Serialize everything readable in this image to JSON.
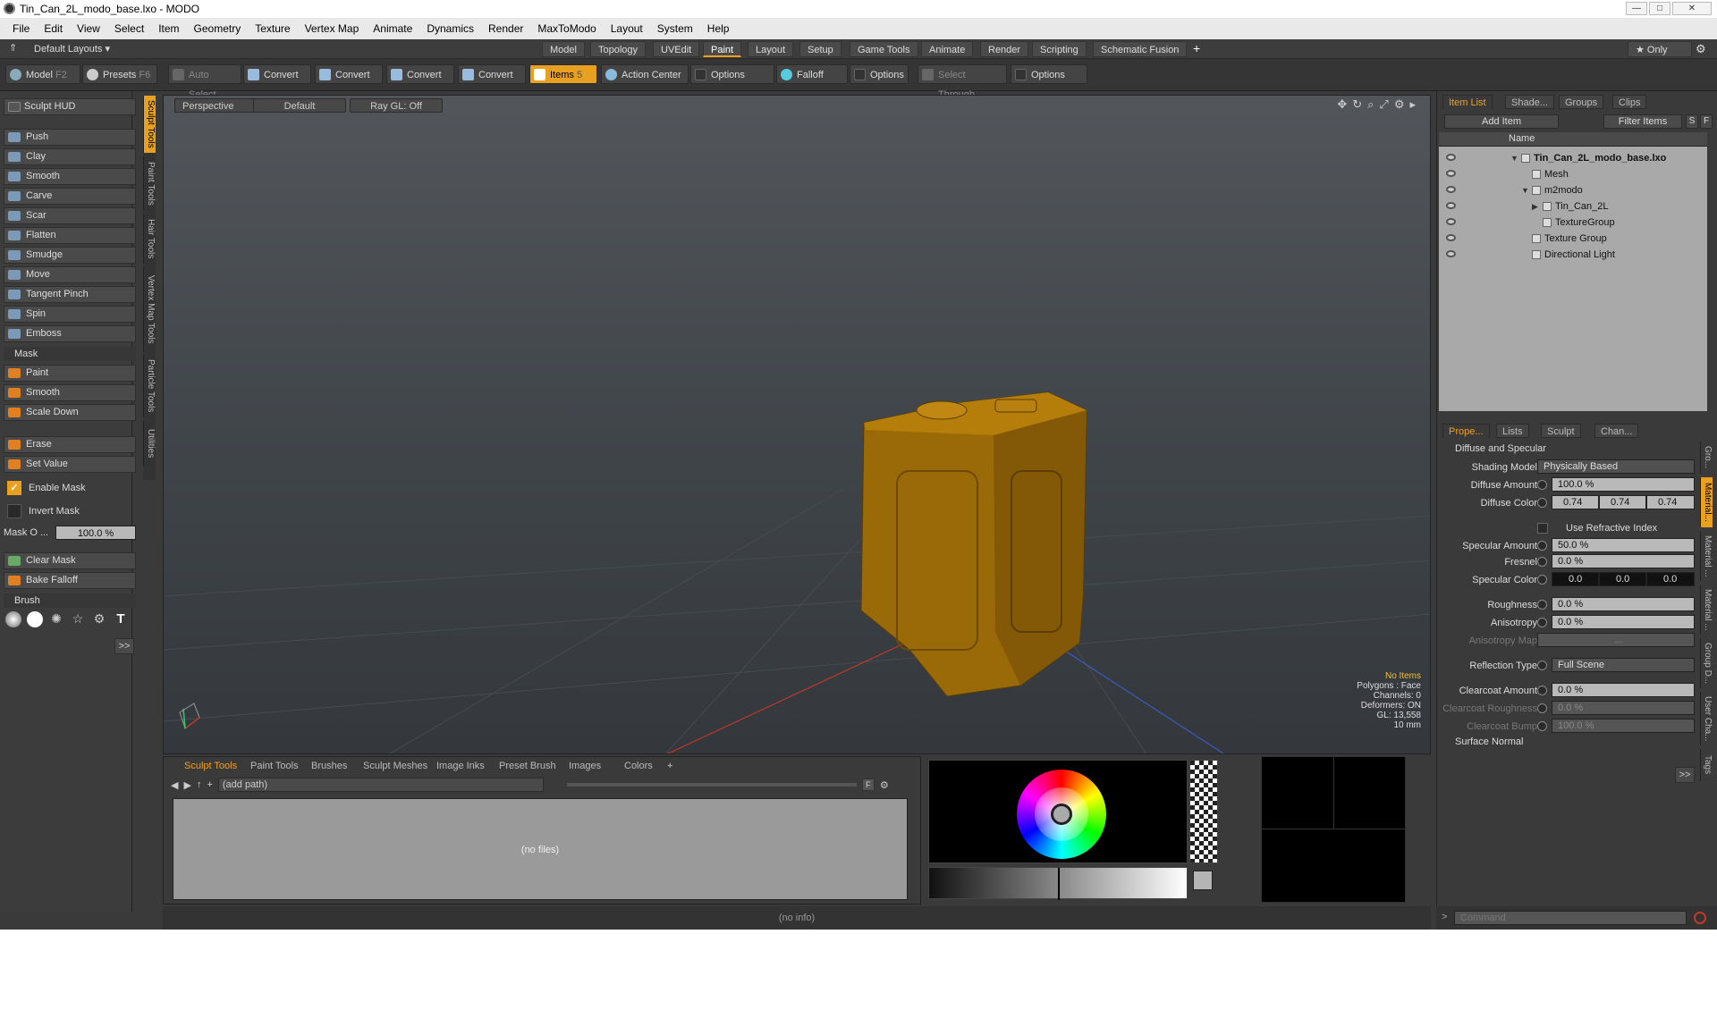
{
  "window": {
    "title": "Tin_Can_2L_modo_base.lxo - MODO",
    "min": "—",
    "max": "□",
    "close": "✕"
  },
  "menu": [
    "File",
    "Edit",
    "View",
    "Select",
    "Item",
    "Geometry",
    "Texture",
    "Vertex Map",
    "Animate",
    "Dynamics",
    "Render",
    "MaxToModo",
    "Layout",
    "System",
    "Help"
  ],
  "layout_bar": {
    "default_layouts": "Default Layouts ▾",
    "tabs": [
      "Model",
      "Topology",
      "UVEdit",
      "Paint",
      "Layout",
      "Setup",
      "Game Tools",
      "Animate",
      "Render",
      "Scripting",
      "Schematic Fusion"
    ],
    "active_tab": "Paint",
    "add": "+",
    "only": "★ Only",
    "gear": "⚙"
  },
  "toolbar": {
    "model": "Model",
    "model_key": "F2",
    "presets": "Presets",
    "presets_key": "F6",
    "auto_select": "Auto Select",
    "convert": "Convert",
    "items": "Items",
    "items_key": "5",
    "action_center": "Action Center",
    "options": "Options",
    "falloff": "Falloff",
    "select_through": "Select Through"
  },
  "left_panel": {
    "sculpt_hud": "Sculpt HUD",
    "tools": [
      "Push",
      "Clay",
      "Smooth",
      "Carve",
      "Scar",
      "Flatten",
      "Smudge",
      "Move",
      "Tangent Pinch",
      "Spin",
      "Emboss"
    ],
    "mask_header": "Mask",
    "mask_tools": [
      "Paint",
      "Smooth",
      "Scale Down"
    ],
    "erase": "Erase",
    "set_value": "Set Value",
    "enable_mask": "Enable Mask",
    "invert_mask": "Invert Mask",
    "mask_opacity_label": "Mask O ...",
    "mask_opacity_value": "100.0 %",
    "clear_mask": "Clear Mask",
    "bake_falloff": "Bake Falloff",
    "brush_header": "Brush",
    "more": ">>",
    "vertical_tabs": [
      "Sculpt Tools",
      "Paint Tools",
      "Hair Tools",
      "Vertex Map Tools",
      "Particle Tools",
      "Utilities"
    ]
  },
  "viewport": {
    "view": "Perspective",
    "shading": "Default",
    "raygl": "Ray GL: Off",
    "info": [
      "No Items",
      "Polygons : Face",
      "Channels: 0",
      "Deformers: ON",
      "GL: 13,558",
      "10 mm"
    ]
  },
  "item_list": {
    "tabs": [
      "Item List",
      "Shade...",
      "Groups",
      "Clips"
    ],
    "add_item": "Add Item",
    "filter": "Filter Items",
    "s": "S",
    "f": "F",
    "name_col": "Name",
    "rows": [
      {
        "label": "Tin_Can_2L_modo_base.lxo",
        "indent": 0,
        "arrow": "▼"
      },
      {
        "label": "Mesh",
        "indent": 1,
        "arrow": ""
      },
      {
        "label": "m2modo",
        "indent": 1,
        "arrow": "▼"
      },
      {
        "label": "Tin_Can_2L",
        "indent": 2,
        "arrow": "▶"
      },
      {
        "label": "TextureGroup",
        "indent": 2,
        "arrow": ""
      },
      {
        "label": "Texture Group",
        "indent": 1,
        "arrow": ""
      },
      {
        "label": "Directional Light",
        "indent": 1,
        "arrow": ""
      }
    ]
  },
  "properties": {
    "tabs": [
      "Prope...",
      "Lists",
      "Sculpt",
      "Chan..."
    ],
    "section": "Diffuse and Specular",
    "shading_model": "Physically Based",
    "diffuse_amount": "100.0 %",
    "diffuse_color": [
      "0.74",
      "0.74",
      "0.74"
    ],
    "use_refractive": "Use Refractive Index",
    "specular_amount": "50.0 %",
    "fresnel": "0.0 %",
    "specular_color": [
      "0.0",
      "0.0",
      "0.0"
    ],
    "roughness": "0.0 %",
    "anisotropy": "0.0 %",
    "anisotropy_map": "...",
    "reflection_type": "Full Scene",
    "clearcoat_amount": "0.0 %",
    "clearcoat_roughness": "0.0 %",
    "clearcoat_bump": "100.0 %",
    "surface_normal": "Surface Normal",
    "labels": {
      "shading_model": "Shading Model",
      "diffuse_amount": "Diffuse Amount",
      "diffuse_color": "Diffuse Color",
      "specular_amount": "Specular Amount",
      "fresnel": "Fresnel",
      "specular_color": "Specular Color",
      "roughness": "Roughness",
      "anisotropy": "Anisotropy",
      "anisotropy_map": "Anisotropy Map",
      "reflection_type": "Reflection Type",
      "clearcoat_amount": "Clearcoat Amount",
      "clearcoat_roughness": "Clearcoat Roughness",
      "clearcoat_bump": "Clearcoat Bump"
    },
    "side_tabs": [
      "Gro...",
      "Material...",
      "Material ...",
      "Material ...",
      "Group D...",
      "User Cha...",
      "Tags"
    ]
  },
  "bottom": {
    "tabs": [
      "Sculpt Tools",
      "Paint Tools",
      "Brushes",
      "Sculpt Meshes",
      "Image Inks",
      "Preset Brush",
      "Images",
      "Colors"
    ],
    "add": "+",
    "path": "(add path)",
    "no_files": "(no files)",
    "f": "F"
  },
  "status": {
    "info": "(no info)",
    "command_placeholder": "Command",
    "prompt": ">"
  },
  "colors": {
    "accent": "#e8a020",
    "can": "#a8700a"
  }
}
